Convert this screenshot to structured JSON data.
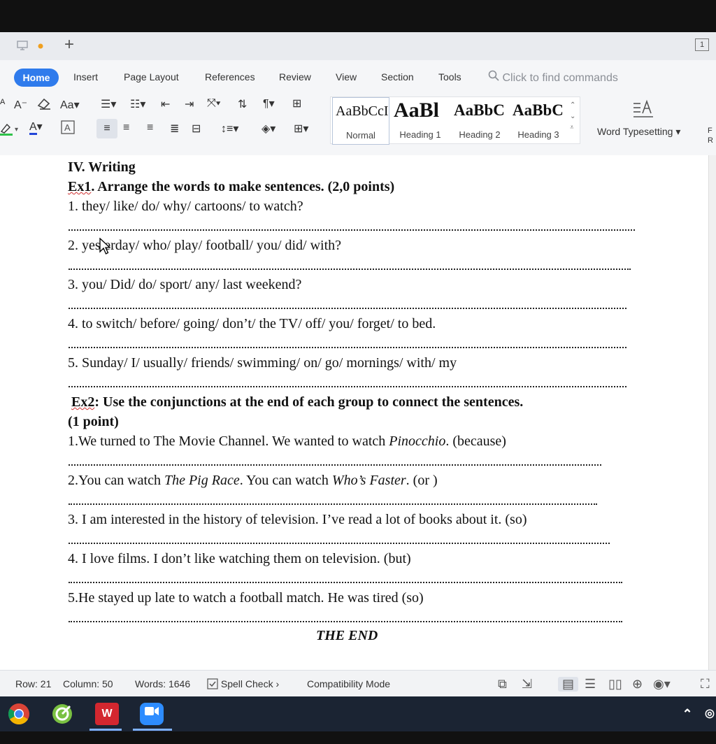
{
  "tabbar": {
    "new_tab_glyph": "+",
    "window_badge": "1"
  },
  "menubar": {
    "items": [
      "Home",
      "Insert",
      "Page Layout",
      "References",
      "Review",
      "View",
      "Section",
      "Tools"
    ],
    "find_placeholder": "Click to find commands"
  },
  "ribbon": {
    "styles": [
      {
        "sample": "AaBbCcI",
        "label": "Normal"
      },
      {
        "sample": "AaBl",
        "label": "Heading 1"
      },
      {
        "sample": "AaBbC",
        "label": "Heading 2"
      },
      {
        "sample": "AaBbC",
        "label": "Heading 3"
      }
    ],
    "word_typesetting": "Word Typesetting",
    "cut_label": "F\nR",
    "font_case_label": "Aa",
    "font_color_letter": "A"
  },
  "document": {
    "section_title": "IV. Writing",
    "ex1_title_ex": "Ex1",
    "ex1_title_rest": ". Arrange the words to make sentences. (2,0 points)",
    "ex1_items": [
      "1.  they/ like/ do/ why/ cartoons/ to watch?",
      "2. yesterday/ who/ play/ football/ you/ did/ with?",
      "3. you/ Did/ do/ sport/ any/ last weekend?",
      "4. to switch/ before/ going/ don’t/ the TV/ off/ you/ forget/ to bed.",
      "5. Sunday/ I/ usually/ friends/ swimming/ on/ go/ mornings/ with/ my"
    ],
    "ex2_title_ex": "Ex2",
    "ex2_title_rest": ": Use the conjunctions at the end of each group to connect the sentences.",
    "ex2_points": "(1 point)",
    "ex2_item1_a": "1.We turned to The Movie Channel. We wanted to watch ",
    "ex2_item1_i": "Pinocchio",
    "ex2_item1_b": ". (because)",
    "ex2_item2_a": "2.You can watch ",
    "ex2_item2_i1": "The Pig Race",
    "ex2_item2_b": ". You can watch ",
    "ex2_item2_i2": "Who’s Faster",
    "ex2_item2_c": ". (or )",
    "ex2_item3": "3. I am interested in the history of television. I’ve read a lot of books about it. (so)",
    "ex2_item4": "4. I love films. I don’t like watching them on television. (but)",
    "ex2_item5": "5.He stayed up late to watch a football  match. He was tired (so)",
    "the_end": "THE END"
  },
  "statusbar": {
    "row": "Row: 21",
    "column": "Column: 50",
    "words": "Words: 1646",
    "spell_check": "Spell Check",
    "compat": "Compatibility Mode"
  },
  "taskbar": {
    "wps_label": "W"
  }
}
